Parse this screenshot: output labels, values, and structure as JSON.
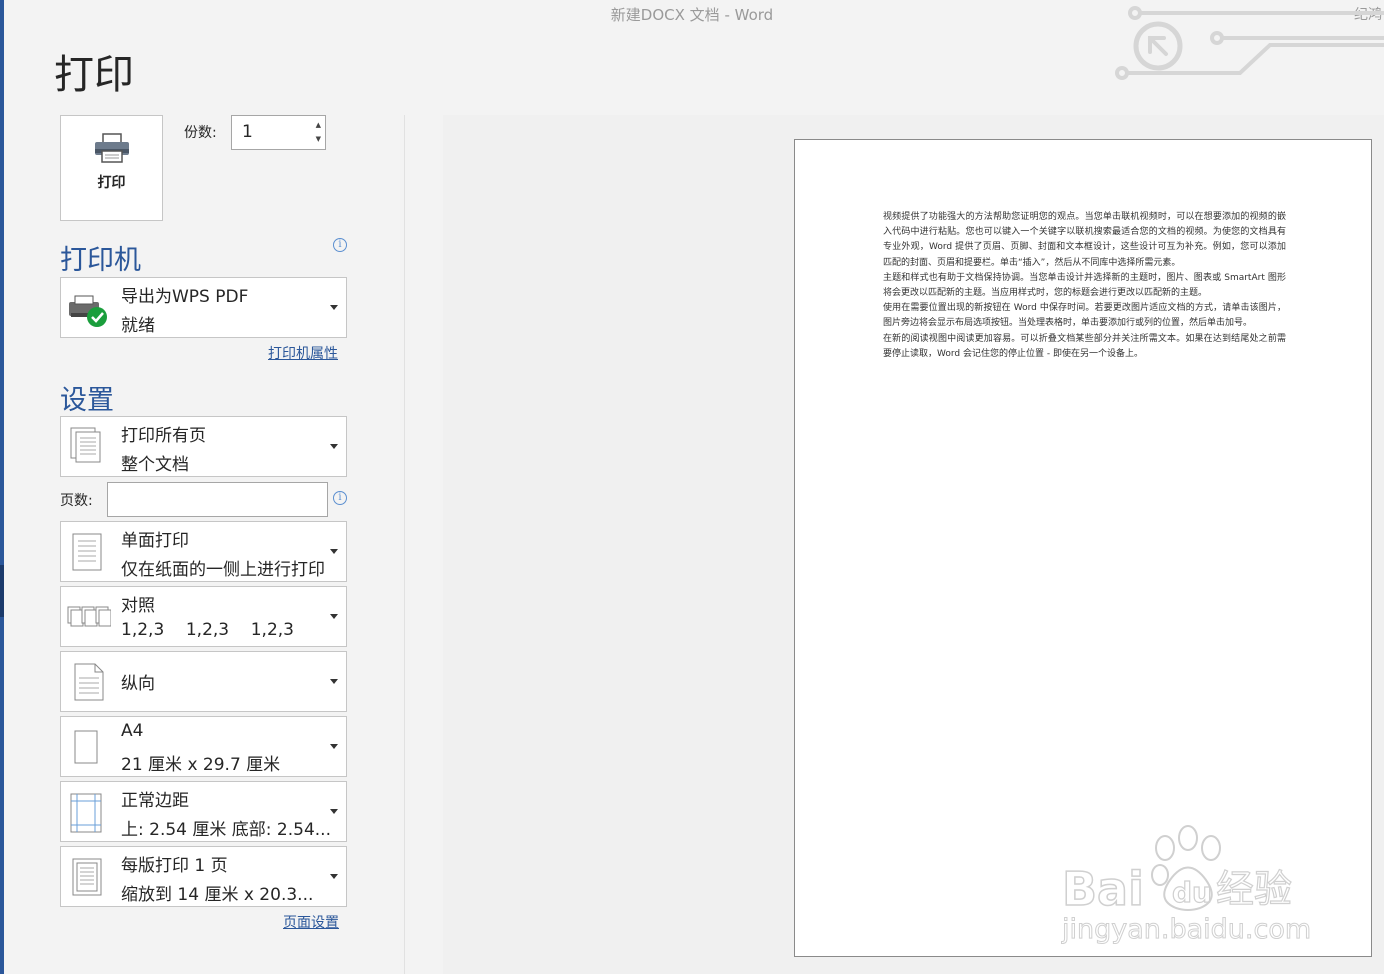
{
  "window": {
    "title": "新建DOCX 文档  -  Word",
    "user": "纪鸿"
  },
  "page_title": "打印",
  "print_button": {
    "label": "打印"
  },
  "copies": {
    "label": "份数:",
    "value": "1"
  },
  "printer": {
    "section_title": "打印机",
    "name": "导出为WPS PDF",
    "status": "就绪",
    "properties_link": "打印机属性"
  },
  "settings": {
    "section_title": "设置",
    "pages_label": "页数:",
    "pages_value": "",
    "dropdowns": [
      {
        "line1": "打印所有页",
        "line2": "整个文档",
        "icon": "pages-stack-icon"
      },
      {
        "line1": "单面打印",
        "line2": "仅在纸面的一侧上进行打印",
        "icon": "single-sided-icon"
      },
      {
        "line1": "对照",
        "line2": "1,2,3    1,2,3    1,2,3",
        "icon": "collate-icon"
      },
      {
        "line1": "纵向",
        "line2": "",
        "icon": "portrait-icon"
      },
      {
        "line1": "A4",
        "line2": "21 厘米 x 29.7 厘米",
        "icon": "paper-size-icon"
      },
      {
        "line1": "正常边距",
        "line2": "上: 2.54 厘米 底部: 2.54...",
        "icon": "margins-icon"
      },
      {
        "line1": "每版打印 1 页",
        "line2": "缩放到 14 厘米 x 20.3...",
        "icon": "pages-per-sheet-icon"
      }
    ],
    "page_setup_link": "页面设置"
  },
  "preview": {
    "paragraphs": [
      "视频提供了功能强大的方法帮助您证明您的观点。当您单击联机视频时，可以在想要添加的视频的嵌入代码中进行粘贴。您也可以键入一个关键字以联机搜索最适合您的文档的视频。为使您的文档具有专业外观，Word 提供了页眉、页脚、封面和文本框设计，这些设计可互为补充。例如，您可以添加匹配的封面、页眉和提要栏。单击“插入”，然后从不同库中选择所需元素。",
      "主题和样式也有助于文档保持协调。当您单击设计并选择新的主题时，图片、图表或 SmartArt 图形将会更改以匹配新的主题。当应用样式时，您的标题会进行更改以匹配新的主题。",
      "使用在需要位置出现的新按钮在 Word 中保存时间。若要更改图片适应文档的方式，请单击该图片，图片旁边将会显示布局选项按钮。当处理表格时，单击要添加行或列的位置，然后单击加号。",
      "在新的阅读视图中阅读更加容易。可以折叠文档某些部分并关注所需文本。如果在达到结尾处之前需要停止读取，Word 会记住您的停止位置 - 即使在另一个设备上。"
    ]
  },
  "watermark": {
    "brand": "Bai du 经验",
    "url": "jingyan.baidu.com"
  },
  "colors": {
    "accent": "#2b579a",
    "background": "#f3f3f3",
    "status_ok": "#1a9e3c"
  }
}
